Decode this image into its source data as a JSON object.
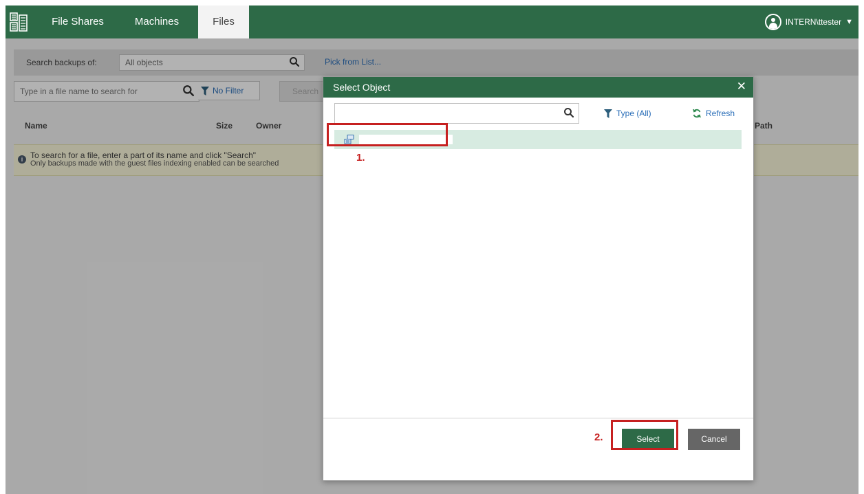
{
  "nav": {
    "tabs": [
      {
        "label": "File Shares"
      },
      {
        "label": "Machines"
      },
      {
        "label": "Files"
      }
    ],
    "user": "INTERN\\ttester"
  },
  "search_strip": {
    "label": "Search backups of:",
    "objects_value": "All objects",
    "pick_link": "Pick from List..."
  },
  "file_search": {
    "placeholder": "Type in a file name to search for",
    "filter_label": "No Filter",
    "search_button": "Search"
  },
  "columns": [
    "Name",
    "Size",
    "Owner",
    "Path"
  ],
  "info": {
    "line1": "To search for a file, enter a part of its name and click \"Search\"",
    "line2": "Only backups made with the guest files indexing enabled can be searched"
  },
  "dialog": {
    "title": "Select Object",
    "close_glyph": "✕",
    "type_filter": "Type (All)",
    "refresh": "Refresh",
    "select_button": "Select",
    "cancel_button": "Cancel",
    "rows": [
      {
        "name": ""
      }
    ]
  },
  "annotations": {
    "step1": "1.",
    "step2": "2.",
    "color": "#c62020"
  },
  "colors": {
    "brand_green": "#2d6a47",
    "link_blue": "#2a6eb8",
    "row_selected": "#d7ebe1"
  },
  "icons": [
    "app-logo-icon",
    "search-icon",
    "filter-icon",
    "refresh-icon",
    "close-icon",
    "user-avatar-icon",
    "chevron-down-icon",
    "info-icon",
    "vm-object-icon"
  ]
}
